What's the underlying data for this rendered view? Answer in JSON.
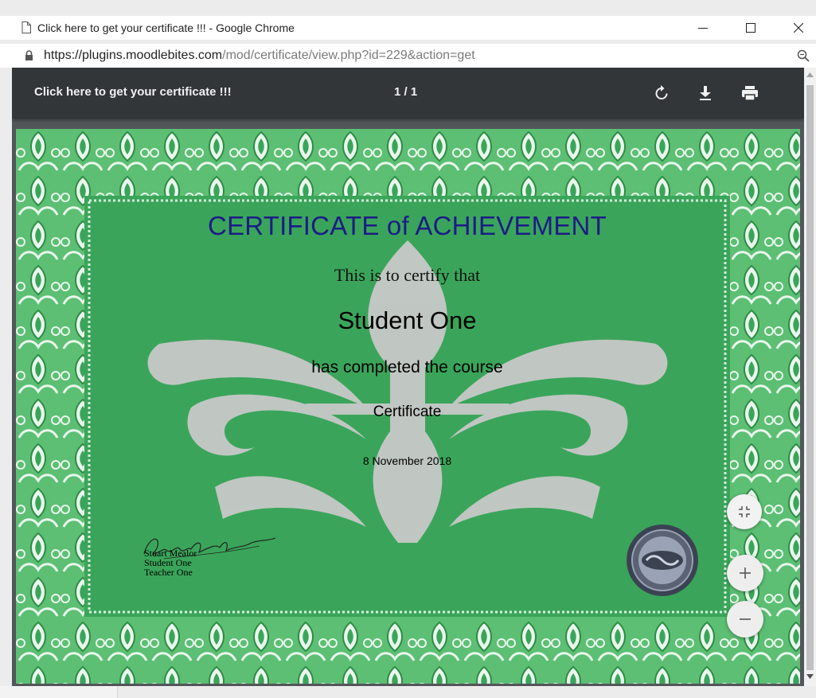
{
  "window": {
    "title": "Click here to get your certificate !!! - Google Chrome",
    "controls": {
      "minimize": "—",
      "maximize": "☐",
      "close": "✕"
    }
  },
  "address_bar": {
    "url_host": "https://plugins.moodlebites.com",
    "url_path": "/mod/certificate/view.php?id=229&action=get"
  },
  "pdf_viewer": {
    "document_title": "Click here to get your certificate !!!",
    "page_counter": "1 / 1",
    "toolbar": {
      "rotate_icon": "rotate-icon",
      "download_icon": "download-icon",
      "print_icon": "print-icon"
    },
    "zoom_controls": {
      "fit_icon": "fit-to-page-icon",
      "zoom_in": "+",
      "zoom_out": "−"
    }
  },
  "certificate": {
    "heading": "CERTIFICATE of ACHIEVEMENT",
    "certify_line": "This is to certify that",
    "student_name": "Student One",
    "completed_line": "has completed the course",
    "course_name": "Certificate",
    "date": "8 November 2018",
    "signatures": [
      "Stuart Mealor",
      "Student One",
      "Teacher One"
    ],
    "colors": {
      "heading": "#1c1c86",
      "border_green": "#3aa55a",
      "watermark": "#c8c8c8"
    }
  }
}
